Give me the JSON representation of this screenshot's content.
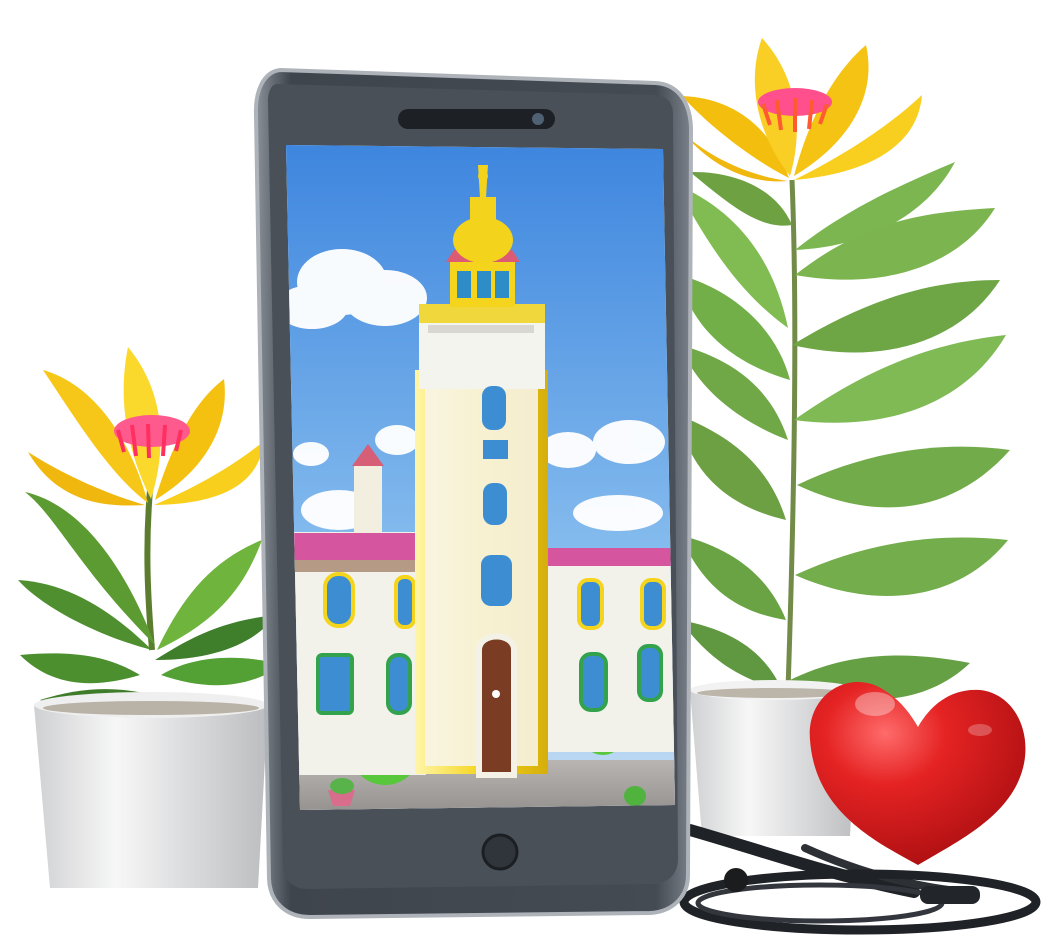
{
  "scene": {
    "objects": [
      "smartphone",
      "church-tower-illustration",
      "left-potted-flower",
      "right-potted-plant",
      "red-heart",
      "stethoscope"
    ]
  },
  "colors": {
    "background": "#ffffff",
    "phone_body": "#5a6068",
    "phone_bezel": "#3e444b",
    "phone_screen_sky": "#4c8fe0",
    "church_yellow": "#f4d41d",
    "church_white": "#f4f4ef",
    "church_trim_pink": "#d94f9b",
    "window_blue": "#3b8fd1",
    "door_brown": "#7a3d24",
    "flower_yellow": "#f6cb1a",
    "flower_center_pink": "#ff4f8a",
    "leaf_green": "#5b9f3b",
    "pot_white": "#e7e7e7",
    "heart_red": "#d81f1f",
    "stethoscope_dark": "#1f2226"
  },
  "icons": {
    "phone": "smartphone-icon",
    "heart": "heart-icon",
    "stethoscope": "stethoscope-icon",
    "flower": "flower-icon"
  }
}
